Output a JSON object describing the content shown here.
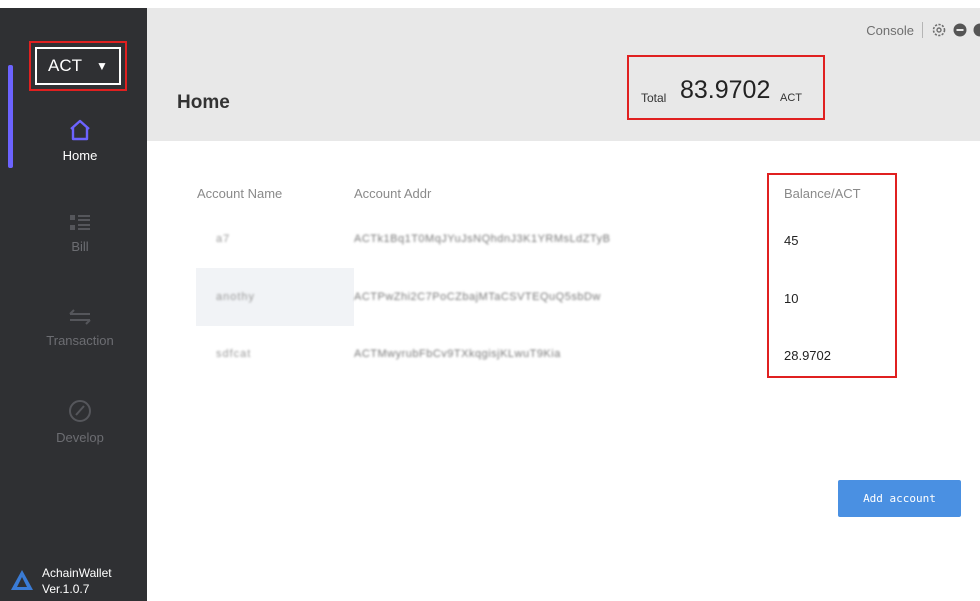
{
  "header": {
    "console_label": "Console",
    "title": "Home",
    "total": {
      "label": "Total",
      "value": "83.9702",
      "unit": "ACT"
    }
  },
  "sidebar": {
    "currency": "ACT",
    "nav": [
      {
        "label": "Home",
        "icon": "home-icon",
        "active": true
      },
      {
        "label": "Bill",
        "icon": "bill-icon",
        "active": false
      },
      {
        "label": "Transaction",
        "icon": "transaction-icon",
        "active": false
      },
      {
        "label": "Develop",
        "icon": "develop-icon",
        "active": false
      }
    ],
    "brand": {
      "name": "AchainWallet",
      "version": "Ver.1.0.7"
    }
  },
  "table": {
    "columns": [
      "Account Name",
      "Account Addr",
      "Balance/ACT"
    ],
    "rows": [
      {
        "name": "a7",
        "address": "ACTk1Bq1T0MqJYuJsNQhdnJ3K1YRMsLdZTyB",
        "balance": "45"
      },
      {
        "name": "anothy",
        "address": "ACTPwZhi2C7PoCZbajMTaCSVTEQuQ5sbDw",
        "balance": "10"
      },
      {
        "name": "sdfcat",
        "address": "ACTMwyrubFbCv9TXkqgisjKLwuT9Kia",
        "balance": "28.9702"
      }
    ]
  },
  "actions": {
    "add_account": "Add account"
  },
  "colors": {
    "accent": "#6c63ff",
    "sidebar_bg": "#2f3033",
    "button": "#4a90e2",
    "highlight": "#e02020",
    "header_bg": "#e8e8e8"
  }
}
